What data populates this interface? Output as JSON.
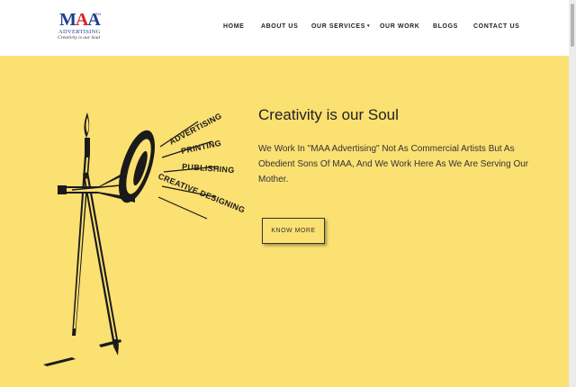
{
  "logo": {
    "mark": "MAA",
    "mark_first": "M",
    "mark_rest_a": "A",
    "mark_rest_b": "A",
    "tm": "TM",
    "name": "ADVERTISING",
    "tagline": "Creativity is our Soul"
  },
  "nav": {
    "items": [
      {
        "label": "HOME"
      },
      {
        "label": "ABOUT US"
      },
      {
        "label": "OUR SERVICES"
      },
      {
        "label": "OUR WORK"
      },
      {
        "label": "BLOGS"
      },
      {
        "label": "CONTACT US"
      }
    ]
  },
  "hero": {
    "heading": "Creativity is our Soul",
    "paragraph": "We Work In \"MAA Advertising\" Not As Commercial Artists But As Obedient Sons Of MAA, And We Work Here As We Are Serving Our Mother.",
    "button_label": "KNOW MORE",
    "background": "#fbe072"
  },
  "illustration": {
    "words": [
      "ADVERTISING",
      "PRINTING",
      "PUBLISHING",
      "CREATIVE DESIGNING"
    ],
    "icons": [
      "paintbrush-icon",
      "pen-nib-icon",
      "megaphone-icon"
    ]
  },
  "colors": {
    "brand_blue": "#1d3f8f",
    "brand_red": "#d4212a",
    "text": "#222222"
  }
}
